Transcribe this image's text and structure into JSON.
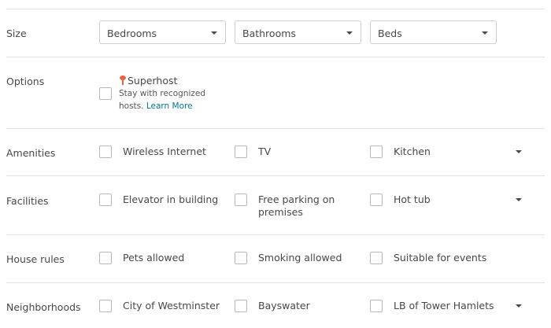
{
  "size": {
    "label": "Size",
    "bedrooms": "Bedrooms",
    "bathrooms": "Bathrooms",
    "beds": "Beds"
  },
  "options": {
    "label": "Options",
    "superhost_title": "Superhost",
    "superhost_desc_1": "Stay with recognized",
    "superhost_desc_2": "hosts.",
    "learn_more": "Learn More"
  },
  "amenities": {
    "label": "Amenities",
    "items": [
      {
        "label": "Wireless Internet"
      },
      {
        "label": "TV"
      },
      {
        "label": "Kitchen"
      }
    ]
  },
  "facilities": {
    "label": "Facilities",
    "items": [
      {
        "label": "Elevator in building"
      },
      {
        "label_1": "Free parking on",
        "label_2": "premises"
      },
      {
        "label": "Hot tub"
      }
    ]
  },
  "house_rules": {
    "label": "House rules",
    "items": [
      {
        "label": "Pets allowed"
      },
      {
        "label": "Smoking allowed"
      },
      {
        "label": "Suitable for events"
      }
    ]
  },
  "neighborhoods": {
    "label": "Neighborhoods",
    "items": [
      {
        "label": "City of Westminster"
      },
      {
        "label": "Bayswater"
      },
      {
        "label": "LB of Tower Hamlets"
      }
    ]
  },
  "colors": {
    "accent_link": "#007a87",
    "superhost_icon": "#e8643c"
  }
}
